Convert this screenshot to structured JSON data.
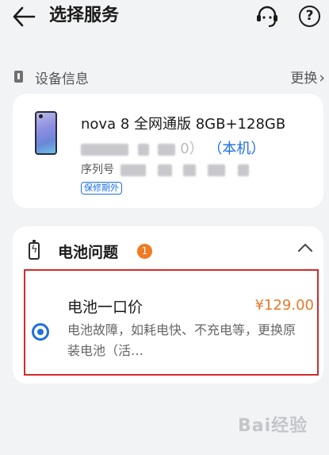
{
  "header": {
    "title": "选择服务"
  },
  "device_section": {
    "title": "设备信息",
    "change_label": "更换"
  },
  "device": {
    "name": "nova 8 全网通版 8GB+128GB",
    "imei_suffix": "0）",
    "this_device_label": "（本机）",
    "serial_label": "序列号",
    "warranty_label": "保修期外"
  },
  "battery_section": {
    "title": "电池问题",
    "count": "1",
    "option": {
      "name": "电池一口价",
      "price": "¥129.00",
      "description": "电池故障，如耗电快、不充电等，更换原装电池（活…",
      "selected": true
    }
  },
  "watermark": {
    "text": "Bai经验"
  },
  "colors": {
    "accent": "#1f6fe0",
    "price": "#e8792a",
    "badge": "#ef7b22",
    "highlight_border": "#d12a2a"
  }
}
